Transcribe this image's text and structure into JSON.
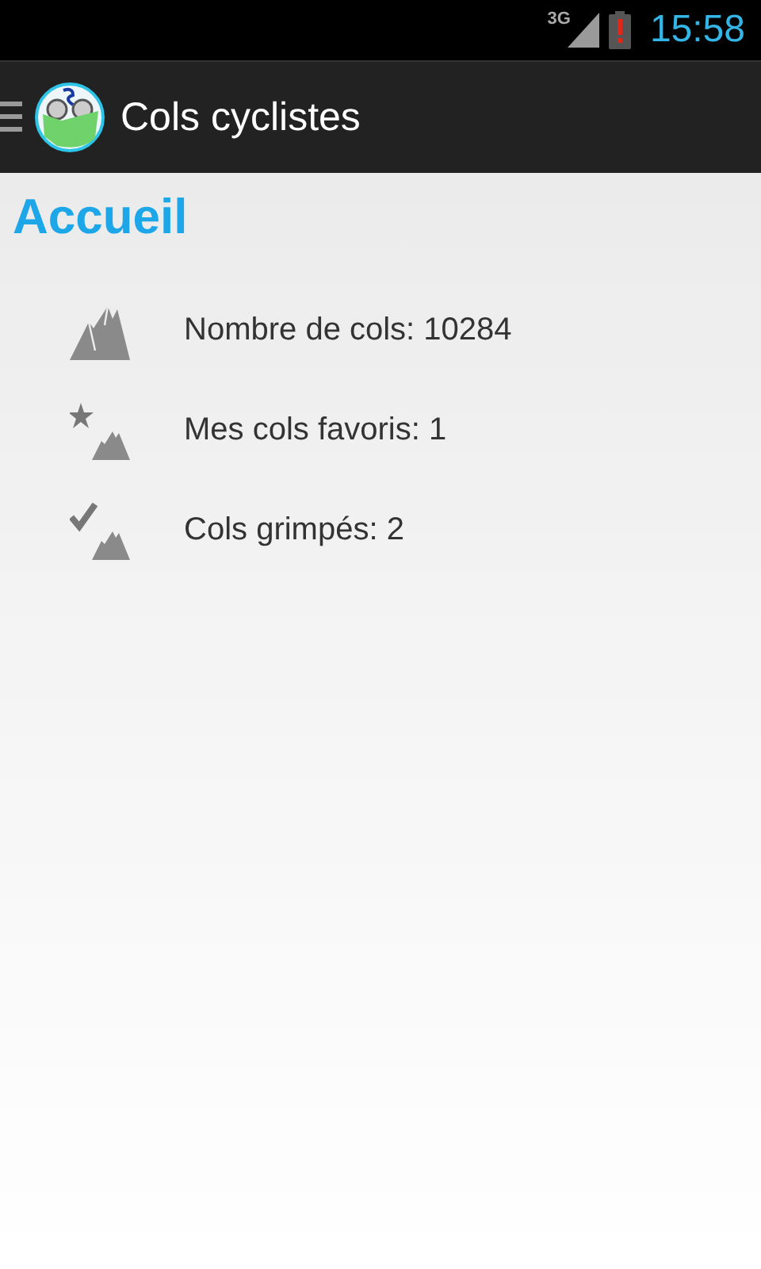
{
  "status_bar": {
    "network": "3G",
    "time": "15:58"
  },
  "action_bar": {
    "title": "Cols cyclistes"
  },
  "heading": "Accueil",
  "items": [
    {
      "kind": "all",
      "label": "Nombre de cols: 10284"
    },
    {
      "kind": "favorite",
      "label": "Mes cols favoris: 1"
    },
    {
      "kind": "climbed",
      "label": "Cols grimpés: 2"
    }
  ]
}
